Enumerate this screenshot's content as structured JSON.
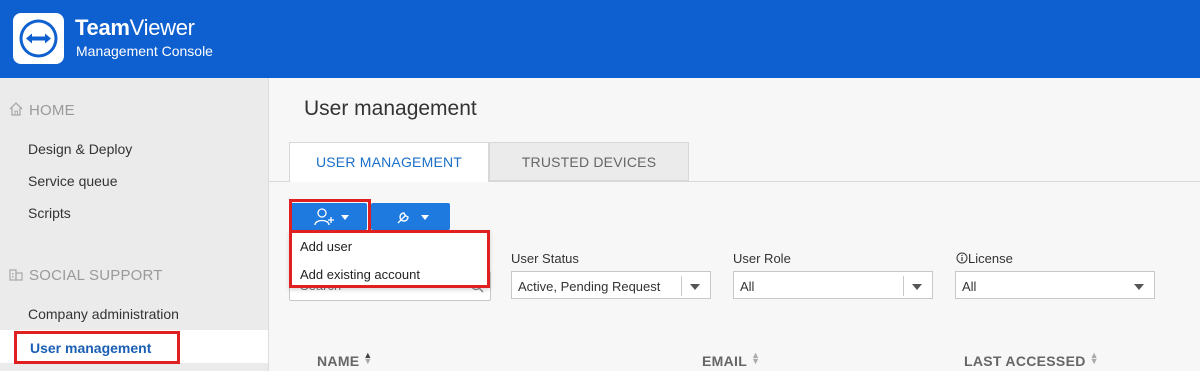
{
  "header": {
    "brand_bold": "Team",
    "brand_light": "Viewer",
    "subtitle": "Management Console",
    "bg_color": "#0e5fcf"
  },
  "sidebar": {
    "sections": [
      {
        "label": "HOME",
        "icon": "home-icon",
        "items": [
          "Design & Deploy",
          "Service queue",
          "Scripts"
        ]
      },
      {
        "label": "SOCIAL SUPPORT",
        "icon": "building-icon",
        "items": [
          "Company administration",
          "User management"
        ]
      }
    ],
    "active_item": "User management"
  },
  "main": {
    "title": "User management",
    "tabs": [
      {
        "label": "USER MANAGEMENT",
        "active": true
      },
      {
        "label": "TRUSTED DEVICES",
        "active": false
      }
    ],
    "toolbar": {
      "add_user_icon": "add-user-icon",
      "tools_icon": "wrench-icon"
    },
    "add_menu": [
      "Add user",
      "Add existing account"
    ],
    "search": {
      "placeholder": "Search",
      "value": ""
    },
    "filters": [
      {
        "label": "User Status",
        "value": "Active, Pending Request"
      },
      {
        "label": "User Role",
        "value": "All"
      },
      {
        "label": "License",
        "value": "All",
        "icon": "info-icon"
      }
    ],
    "table_columns": [
      {
        "label": "NAME",
        "sort": "asc"
      },
      {
        "label": "EMAIL",
        "sort": "none"
      },
      {
        "label": "LAST ACCESSED",
        "sort": "none"
      }
    ]
  },
  "colors": {
    "accent": "#1f7ae0",
    "highlight": "#e02020",
    "active_link": "#1a5fb4"
  }
}
